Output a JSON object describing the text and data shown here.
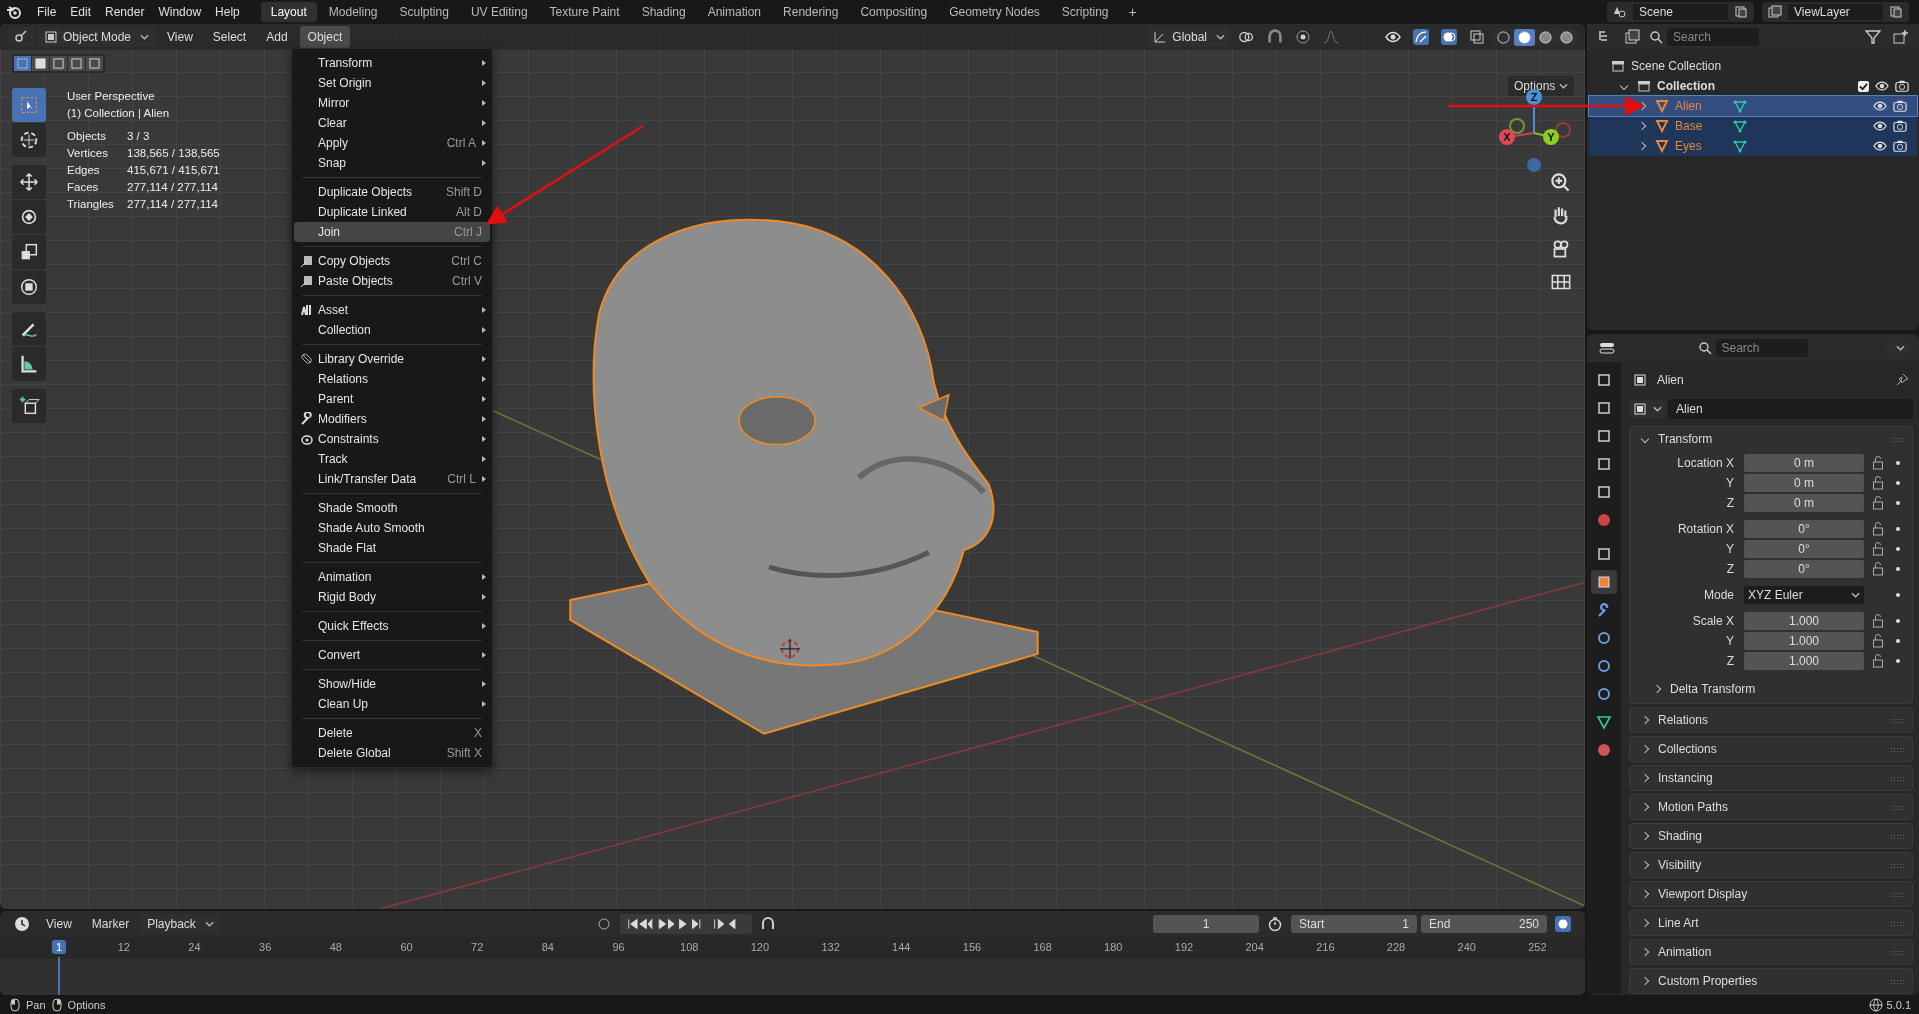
{
  "topbar": {
    "menus": [
      "File",
      "Edit",
      "Render",
      "Window",
      "Help"
    ],
    "workspaces": [
      {
        "label": "Layout",
        "selected": true
      },
      {
        "label": "Modeling",
        "selected": false
      },
      {
        "label": "Sculpting",
        "selected": false
      },
      {
        "label": "UV Editing",
        "selected": false
      },
      {
        "label": "Texture Paint",
        "selected": false
      },
      {
        "label": "Shading",
        "selected": false
      },
      {
        "label": "Animation",
        "selected": false
      },
      {
        "label": "Rendering",
        "selected": false
      },
      {
        "label": "Compositing",
        "selected": false
      },
      {
        "label": "Geometry Nodes",
        "selected": false
      },
      {
        "label": "Scripting",
        "selected": false
      }
    ],
    "add_tab": "+",
    "scene": "Scene",
    "view_layer": "ViewLayer"
  },
  "viewport": {
    "mode": "Object Mode",
    "menus": [
      {
        "label": "View",
        "selected": false
      },
      {
        "label": "Select",
        "selected": false
      },
      {
        "label": "Add",
        "selected": false
      },
      {
        "label": "Object",
        "selected": true
      }
    ],
    "orientation": "Global",
    "options": "Options",
    "select_modes": [
      {
        "selected": true
      },
      {
        "selected": false
      },
      {
        "selected": false
      },
      {
        "selected": false
      },
      {
        "selected": false
      }
    ],
    "shading": [
      {
        "selected": false
      },
      {
        "selected": true
      },
      {
        "selected": false
      },
      {
        "selected": false
      }
    ],
    "tools": [
      {
        "selected": true
      },
      {
        "selected": false
      },
      {
        "selected": false
      },
      {
        "selected": false
      },
      {
        "selected": false
      },
      {
        "selected": false
      },
      {
        "selected": false
      },
      {
        "selected": false
      },
      {
        "selected": false
      }
    ],
    "overlay_title": "User Perspective",
    "overlay_subtitle": "(1) Collection | Alien",
    "stats": [
      {
        "label": "Objects",
        "value": "3 / 3"
      },
      {
        "label": "Vertices",
        "value": "138,565 / 138,565"
      },
      {
        "label": "Edges",
        "value": "415,671 / 415,671"
      },
      {
        "label": "Faces",
        "value": "277,114 / 277,114"
      },
      {
        "label": "Triangles",
        "value": "277,114 / 277,114"
      }
    ],
    "gizmo": {
      "x": "X",
      "y": "Y",
      "z": "Z"
    }
  },
  "object_menu": {
    "groups": [
      [
        {
          "label": "Transform",
          "submenu": true,
          "selected": false
        },
        {
          "label": "Set Origin",
          "submenu": true,
          "selected": false
        },
        {
          "label": "Mirror",
          "submenu": true,
          "selected": false
        },
        {
          "label": "Clear",
          "submenu": true,
          "selected": false
        },
        {
          "label": "Apply",
          "shortcut": "Ctrl A",
          "submenu": true,
          "selected": false
        },
        {
          "label": "Snap",
          "submenu": true,
          "selected": false
        }
      ],
      [
        {
          "label": "Duplicate Objects",
          "shortcut": "Shift D",
          "submenu": false,
          "selected": false
        },
        {
          "label": "Duplicate Linked",
          "shortcut": "Alt D",
          "submenu": false,
          "selected": false
        },
        {
          "label": "Join",
          "shortcut": "Ctrl J",
          "submenu": false,
          "selected": true
        }
      ],
      [
        {
          "label": "Copy Objects",
          "shortcut": "Ctrl C",
          "submenu": false,
          "selected": false
        },
        {
          "label": "Paste Objects",
          "shortcut": "Ctrl V",
          "submenu": false,
          "selected": false
        }
      ],
      [
        {
          "label": "Asset",
          "submenu": true,
          "selected": false
        },
        {
          "label": "Collection",
          "submenu": true,
          "selected": false
        }
      ],
      [
        {
          "label": "Library Override",
          "submenu": true,
          "selected": false
        },
        {
          "label": "Relations",
          "submenu": true,
          "selected": false
        },
        {
          "label": "Parent",
          "submenu": true,
          "selected": false
        },
        {
          "label": "Modifiers",
          "submenu": true,
          "selected": false
        },
        {
          "label": "Constraints",
          "submenu": true,
          "selected": false
        },
        {
          "label": "Track",
          "submenu": true,
          "selected": false
        },
        {
          "label": "Link/Transfer Data",
          "shortcut": "Ctrl L",
          "submenu": true,
          "selected": false
        }
      ],
      [
        {
          "label": "Shade Smooth",
          "submenu": false,
          "selected": false
        },
        {
          "label": "Shade Auto Smooth",
          "submenu": false,
          "selected": false
        },
        {
          "label": "Shade Flat",
          "submenu": false,
          "selected": false
        }
      ],
      [
        {
          "label": "Animation",
          "submenu": true,
          "selected": false
        },
        {
          "label": "Rigid Body",
          "submenu": true,
          "selected": false
        }
      ],
      [
        {
          "label": "Quick Effects",
          "submenu": true,
          "selected": false
        }
      ],
      [
        {
          "label": "Convert",
          "submenu": true,
          "selected": false
        }
      ],
      [
        {
          "label": "Show/Hide",
          "submenu": true,
          "selected": false
        },
        {
          "label": "Clean Up",
          "submenu": true,
          "selected": false
        }
      ],
      [
        {
          "label": "Delete",
          "shortcut": "X",
          "submenu": false,
          "selected": false
        },
        {
          "label": "Delete Global",
          "shortcut": "Shift X",
          "submenu": false,
          "selected": false
        }
      ]
    ]
  },
  "outliner": {
    "search": {
      "placeholder": "Search"
    },
    "root": "Scene Collection",
    "collection": {
      "label": "Collection",
      "expanded": true,
      "checked": true,
      "children": [
        {
          "label": "Alien",
          "selected": true,
          "active": true
        },
        {
          "label": "Base",
          "selected": true,
          "active": false
        },
        {
          "label": "Eyes",
          "selected": true,
          "active": false
        }
      ]
    }
  },
  "properties": {
    "search": {
      "placeholder": "Search"
    },
    "tabs": [
      {
        "selected": false
      },
      {
        "selected": false
      },
      {
        "selected": false
      },
      {
        "selected": false
      },
      {
        "selected": false
      },
      {
        "selected": false
      },
      {
        "selected": false
      },
      {
        "selected": true
      },
      {
        "selected": false
      },
      {
        "selected": false
      },
      {
        "selected": false
      },
      {
        "selected": false
      },
      {
        "selected": false
      },
      {
        "selected": false
      }
    ],
    "object_name": "Alien",
    "name_field": "Alien",
    "transform": {
      "label": "Transform",
      "expanded": true,
      "groups": [
        [
          {
            "label": "Location X",
            "value": "0 m",
            "kind": "number"
          },
          {
            "label": "Y",
            "value": "0 m",
            "kind": "number"
          },
          {
            "label": "Z",
            "value": "0 m",
            "kind": "number"
          }
        ],
        [
          {
            "label": "Rotation X",
            "value": "0°",
            "kind": "number"
          },
          {
            "label": "Y",
            "value": "0°",
            "kind": "number"
          },
          {
            "label": "Z",
            "value": "0°",
            "kind": "number"
          }
        ],
        [
          {
            "label": "Mode",
            "value": "XYZ Euler",
            "kind": "dropdown"
          }
        ],
        [
          {
            "label": "Scale X",
            "value": "1.000",
            "kind": "number"
          },
          {
            "label": "Y",
            "value": "1.000",
            "kind": "number"
          },
          {
            "label": "Z",
            "value": "1.000",
            "kind": "number"
          }
        ]
      ],
      "subpanel": "Delta Transform"
    },
    "panels": [
      "Relations",
      "Collections",
      "Instancing",
      "Motion Paths",
      "Shading",
      "Visibility",
      "Viewport Display",
      "Line Art",
      "Animation",
      "Custom Properties"
    ]
  },
  "timeline": {
    "menus": [
      "View",
      "Marker"
    ],
    "playback": "Playback",
    "current_frame": "1",
    "start_label": "Start",
    "start": "1",
    "end_label": "End",
    "end": "250",
    "ruler": [
      {
        "label": "1",
        "selected": true
      },
      {
        "label": "12",
        "selected": false
      },
      {
        "label": "24",
        "selected": false
      },
      {
        "label": "36",
        "selected": false
      },
      {
        "label": "48",
        "selected": false
      },
      {
        "label": "60",
        "selected": false
      },
      {
        "label": "72",
        "selected": false
      },
      {
        "label": "84",
        "selected": false
      },
      {
        "label": "96",
        "selected": false
      },
      {
        "label": "108",
        "selected": false
      },
      {
        "label": "120",
        "selected": false
      },
      {
        "label": "132",
        "selected": false
      },
      {
        "label": "144",
        "selected": false
      },
      {
        "label": "156",
        "selected": false
      },
      {
        "label": "168",
        "selected": false
      },
      {
        "label": "180",
        "selected": false
      },
      {
        "label": "192",
        "selected": false
      },
      {
        "label": "204",
        "selected": false
      },
      {
        "label": "216",
        "selected": false
      },
      {
        "label": "228",
        "selected": false
      },
      {
        "label": "240",
        "selected": false
      },
      {
        "label": "252",
        "selected": false
      }
    ]
  },
  "status_bar": {
    "hints": [
      "Pan",
      "Options"
    ],
    "version": "5.0.1"
  }
}
